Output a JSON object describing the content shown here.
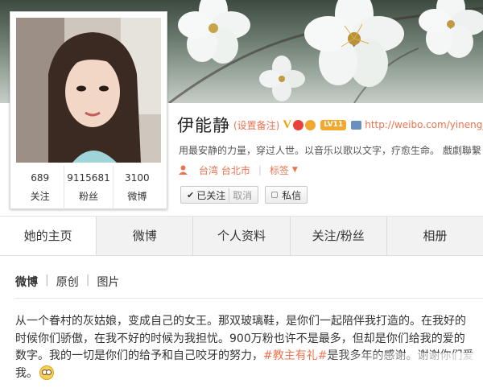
{
  "profile": {
    "name": "伊能静",
    "remark_link": "(设置备注)",
    "verified_badge": "V",
    "level": "LV11",
    "url": "http://weibo.com/yinengjing",
    "intro": "用最安静的力量，穿过人世。以音乐以歌以文字，疗愈生命。 戲劇聯繫",
    "location": "台湾 台北市",
    "tag_label": "标签"
  },
  "stats": [
    {
      "value": "689",
      "label": "关注"
    },
    {
      "value": "9115681",
      "label": "粉丝"
    },
    {
      "value": "3100",
      "label": "微博"
    }
  ],
  "buttons": {
    "followed": "已关注",
    "cancel": "取消",
    "message": "私信"
  },
  "tabs": [
    "她的主页",
    "微博",
    "个人资料",
    "关注/粉丝",
    "相册"
  ],
  "active_tab": "她的主页",
  "subtabs": [
    "微博",
    "原创",
    "图片"
  ],
  "post": {
    "text_before": "从一个眷村的灰姑娘，变成自己的女王。那双玻璃鞋，是你们一起陪伴我打造的。在我好的时候你们骄傲，在我不好的时候为我担忧。900万粉也许不是最多，但却是你们给我的爱的数字。我的一切是你们的给予和自己咬牙的努力，",
    "hashtag": "#教主有礼#",
    "text_after": "是我多年的感谢。谢谢你们爱我。"
  },
  "colors": {
    "accent": "#eb7350",
    "tab_bg": "#f2f2f2",
    "level_badge": "#f3a830"
  },
  "icons": [
    "check-icon",
    "message-icon",
    "person-icon",
    "caret-down-icon",
    "emoji-icon",
    "crown-icon",
    "home-icon"
  ]
}
